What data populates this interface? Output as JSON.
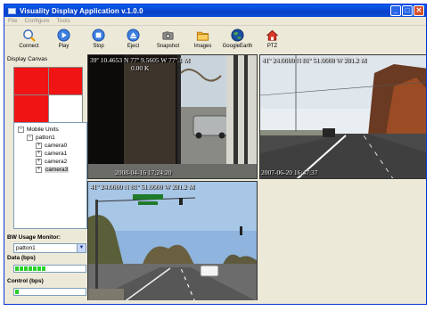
{
  "window": {
    "title": "Visuality Display Application v.1.0.0"
  },
  "menu": [
    "File",
    "Configure",
    "Tools"
  ],
  "toolbar": {
    "buttons": [
      {
        "label": "Connect",
        "icon": "connect-icon"
      },
      {
        "label": "Play",
        "icon": "play-icon"
      },
      {
        "label": "Stop",
        "icon": "stop-icon"
      },
      {
        "label": "Eject",
        "icon": "eject-icon"
      },
      {
        "label": "Snapshot",
        "icon": "snapshot-icon"
      },
      {
        "label": "Images",
        "icon": "folder-icon"
      },
      {
        "label": "GoogleEarth",
        "icon": "globe-icon"
      },
      {
        "label": "PTZ",
        "icon": "home-icon"
      }
    ]
  },
  "left_panel": {
    "canvas_title": "Display Canvas",
    "canvas_cells": [
      "filled",
      "filled",
      "filled",
      "empty"
    ],
    "tree": {
      "root": "Mobile Units",
      "unit": "patton1",
      "cameras": [
        "camera0",
        "camera1",
        "camera2",
        "camera3"
      ],
      "selected": "camera3"
    },
    "bw_title": "BW Usage Monitor:",
    "bw_selected": "patton1",
    "data_title": "Data (bps)",
    "data_level": 0.45,
    "control_title": "Control (bps)",
    "control_level": 0.02
  },
  "videos": [
    {
      "top_text": "39º 10.4653 N 77º 9.5605 W 77º.1 M",
      "top_text2": "0.00 K",
      "bottom_text": "2008-04-16   17:24:20"
    },
    {
      "top_text": "41º 24.0000 N 81º 51.0000 W 281.2 M",
      "bottom_text": "2007-06-20   16:47:37"
    },
    {
      "top_text": "41º 24.0000 N 81º 51.0000 W 281.2 M",
      "bottom_text": ""
    }
  ],
  "colors": {
    "title_bar": "#0840c8",
    "canvas_red": "#f01414",
    "bw_green": "#2bd12b"
  }
}
